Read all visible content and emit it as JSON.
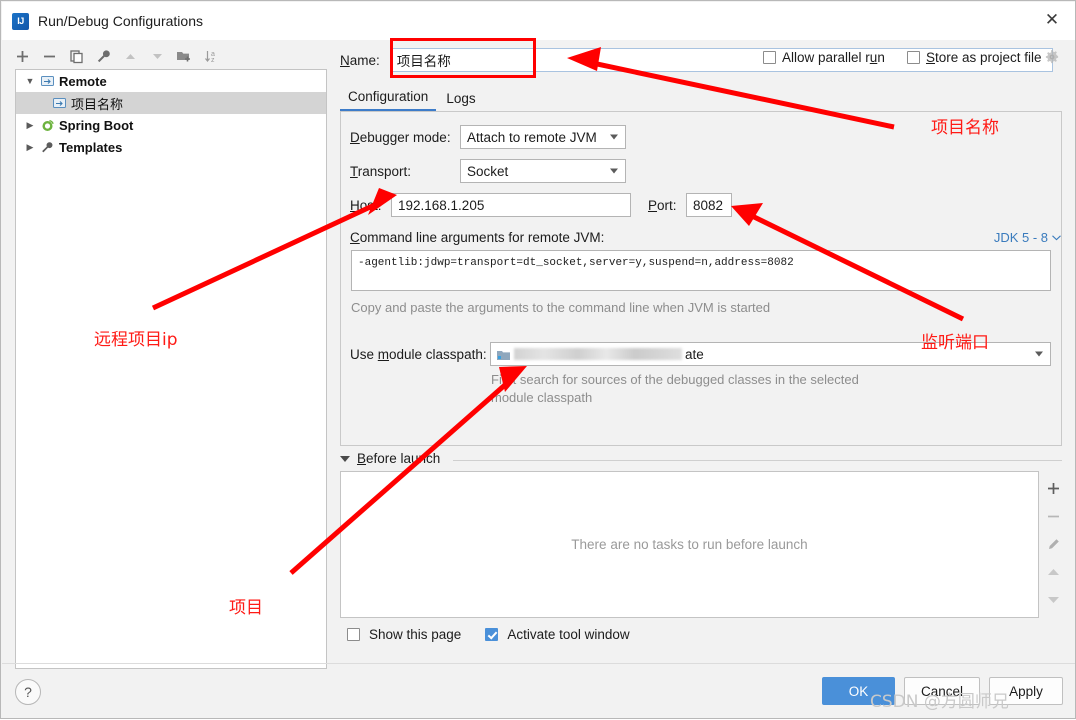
{
  "window": {
    "title": "Run/Debug Configurations",
    "logo_text": "IJ",
    "close_label": "✕"
  },
  "left_panel": {
    "toolbar": [
      {
        "name": "add-configuration-button",
        "label": "+"
      },
      {
        "name": "remove-configuration-button",
        "label": "−"
      },
      {
        "name": "copy-configuration-button",
        "label": "copy-icon"
      },
      {
        "name": "edit-templates-button",
        "label": "wrench-icon"
      },
      {
        "name": "move-up-button",
        "label": "arrow-up-icon"
      },
      {
        "name": "move-down-button",
        "label": "arrow-down-icon"
      },
      {
        "name": "new-folder-button",
        "label": "folder-add-icon"
      },
      {
        "name": "sort-configurations-button",
        "label": "sort-az-icon"
      }
    ],
    "tree": [
      {
        "label": "Remote",
        "expanded": true,
        "selected": false,
        "child": false
      },
      {
        "label": "项目名称",
        "expanded": false,
        "selected": true,
        "child": true
      },
      {
        "label": "Spring Boot",
        "expanded": false,
        "selected": false,
        "child": false
      },
      {
        "label": "Templates",
        "expanded": false,
        "selected": false,
        "child": false
      }
    ]
  },
  "form": {
    "name_label": "Name:",
    "name_value": "项目名称",
    "allow_parallel_run": {
      "label": "Allow parallel run",
      "checked": false
    },
    "store_as_project_file": {
      "label": "Store as project file",
      "checked": false
    },
    "tabs": [
      {
        "label": "Configuration",
        "active": true
      },
      {
        "label": "Logs",
        "active": false
      }
    ],
    "debugger_mode": {
      "label": "Debugger mode:",
      "value": "Attach to remote JVM"
    },
    "transport": {
      "label": "Transport:",
      "value": "Socket"
    },
    "host": {
      "label": "Host:",
      "value": "192.168.1.205"
    },
    "port": {
      "label": "Port:",
      "value": "8082"
    },
    "command_line": {
      "label": "Command line arguments for remote JVM:",
      "value": "-agentlib:jdwp=transport=dt_socket,server=y,suspend=n,address=8082",
      "hint": "Copy and paste the arguments to the command line when JVM is started"
    },
    "jdk_selector": {
      "label": "JDK 5 - 8",
      "carat": "⌄"
    },
    "module_classpath": {
      "label": "Use module classpath:",
      "value_suffix": "ate",
      "hint_line1": "First search for sources of the debugged classes in the selected",
      "hint_line2": "module classpath"
    }
  },
  "before_launch": {
    "title": "Before launch",
    "empty_text": "There are no tasks to run before launch",
    "side_buttons": [
      {
        "name": "add-task-button",
        "label": "+"
      },
      {
        "name": "remove-task-button",
        "label": "−"
      },
      {
        "name": "edit-task-button",
        "label": "pencil-icon"
      },
      {
        "name": "move-task-up-button",
        "label": "arrow-up-icon"
      },
      {
        "name": "move-task-down-button",
        "label": "arrow-down-icon"
      }
    ],
    "show_this_page": {
      "label": "Show this page",
      "checked": false
    },
    "activate_tool_window": {
      "label": "Activate tool window",
      "checked": true
    }
  },
  "footer": {
    "help_label": "?",
    "ok_label": "OK",
    "cancel_label": "Cancel",
    "apply_label": "Apply"
  },
  "annotations": [
    {
      "text": "项目名称",
      "meaning": "project-name"
    },
    {
      "text": "远程项目ip",
      "meaning": "remote-project-ip"
    },
    {
      "text": "监听端口",
      "meaning": "listening-port"
    },
    {
      "text": "项目",
      "meaning": "project"
    }
  ],
  "watermark": "CSDN @方圆师兄",
  "colors": {
    "accent": "#4a90d9",
    "annotation_red": "#ff1a15",
    "link_blue": "#3a7bbd",
    "selection_gray": "#d4d4d4"
  }
}
